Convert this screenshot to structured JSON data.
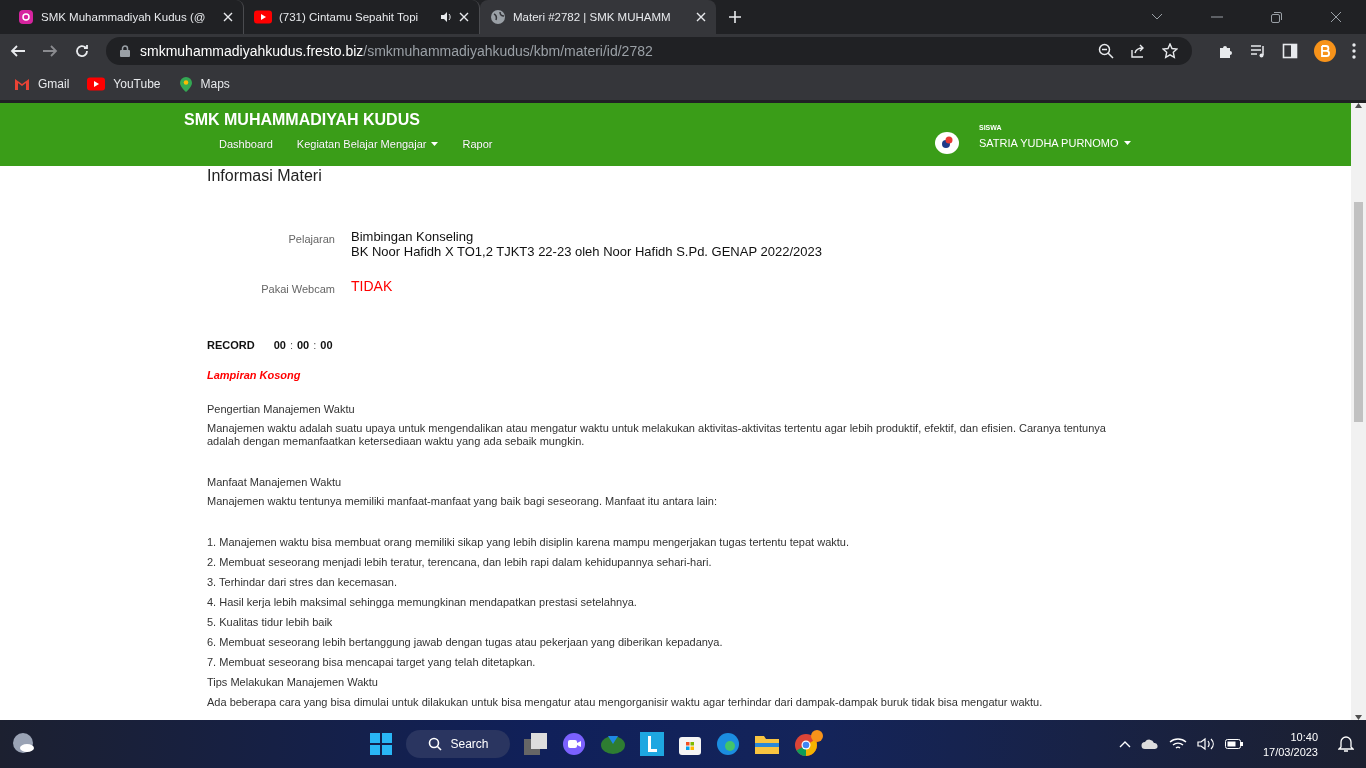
{
  "browser": {
    "tabs": [
      {
        "title": "SMK Muhammadiyah Kudus (@",
        "kind": "instagram",
        "audio": false,
        "selected": false
      },
      {
        "title": "(731) Cintamu Sepahit Topi",
        "kind": "youtube",
        "audio": true,
        "selected": false
      },
      {
        "title": "Materi #2782 | SMK MUHAMM",
        "kind": "globe",
        "audio": false,
        "selected": true
      }
    ],
    "url": {
      "host": "smkmuhammadiyahkudus.fresto.biz",
      "path": "/smkmuhammadiyahkudus/kbm/materi/id/2782"
    },
    "bookmarks": [
      {
        "label": "Gmail",
        "kind": "gmail"
      },
      {
        "label": "YouTube",
        "kind": "youtube"
      },
      {
        "label": "Maps",
        "kind": "maps"
      }
    ]
  },
  "navbar": {
    "brand": "SMK MUHAMMADIYAH KUDUS",
    "menu": [
      {
        "label": "Dashboard",
        "dropdown": false
      },
      {
        "label": "Kegiatan Belajar Mengajar",
        "dropdown": true
      },
      {
        "label": "Rapor",
        "dropdown": false
      }
    ],
    "user": {
      "role": "SISWA",
      "name": "SATRIA YUDHA PURNOMO"
    }
  },
  "content": {
    "heading": "Informasi Materi",
    "fields": [
      {
        "label": "Pelajaran",
        "lines": [
          "Bimbingan Konseling",
          "BK Noor Hafidh X TO1,2 TJKT3 22-23 oleh Noor Hafidh S.Pd.  GENAP 2022/2023"
        ],
        "alert": false
      },
      {
        "label": "Pakai Webcam",
        "lines": [
          "TIDAK"
        ],
        "alert": true
      }
    ],
    "record": {
      "label": "RECORD",
      "time": [
        "00",
        ":",
        "00",
        ":",
        "00"
      ]
    },
    "attachment_note": "Lampiran Kosong",
    "blocks": [
      {
        "kind": "heading",
        "text": "Pengertian Manajemen Waktu"
      },
      {
        "kind": "paragraph",
        "text": "Manajemen waktu adalah suatu upaya untuk mengendalikan atau mengatur waktu untuk melakukan aktivitas-aktivitas tertentu agar lebih produktif, efektif, dan efisien. Caranya tentunya adalah dengan memanfaatkan ketersediaan waktu yang ada sebaik mungkin."
      },
      {
        "kind": "spacer"
      },
      {
        "kind": "heading",
        "text": "Manfaat Manajemen Waktu"
      },
      {
        "kind": "paragraph",
        "text": "Manajemen waktu tentunya memiliki manfaat-manfaat yang baik bagi seseorang. Manfaat itu antara lain:"
      },
      {
        "kind": "spacer"
      },
      {
        "kind": "item",
        "text": "1. Manajemen waktu bisa membuat orang memiliki sikap yang lebih disiplin karena mampu mengerjakan tugas tertentu tepat waktu."
      },
      {
        "kind": "item",
        "text": "2. Membuat seseorang menjadi lebih teratur, terencana, dan lebih rapi dalam kehidupannya sehari-hari."
      },
      {
        "kind": "item",
        "text": "3. Terhindar dari stres dan kecemasan."
      },
      {
        "kind": "item",
        "text": "4. Hasil kerja lebih maksimal sehingga memungkinan mendapatkan prestasi setelahnya."
      },
      {
        "kind": "item",
        "text": "5. Kualitas tidur lebih baik"
      },
      {
        "kind": "item",
        "text": "6. Membuat seseorang lebih bertanggung jawab dengan tugas atau pekerjaan yang diberikan kepadanya."
      },
      {
        "kind": "item",
        "text": "7. Membuat seseorang bisa mencapai target yang telah ditetapkan."
      },
      {
        "kind": "item",
        "text": "Tips Melakukan Manajemen Waktu"
      },
      {
        "kind": "item",
        "text": "Ada beberapa cara yang bisa dimulai untuk dilakukan untuk bisa mengatur atau mengorganisir waktu agar terhindar dari dampak-dampak buruk tidak bisa mengatur waktu."
      }
    ]
  },
  "taskbar": {
    "search": "Search",
    "time": "10:40",
    "date": "17/03/2023"
  }
}
